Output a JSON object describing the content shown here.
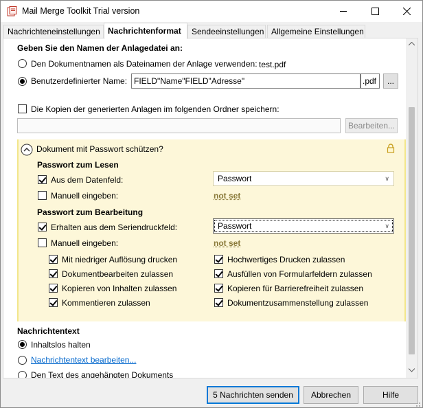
{
  "window": {
    "title": "Mail Merge Toolkit Trial version"
  },
  "tabs": [
    {
      "label": "Nachrichteneinstellungen"
    },
    {
      "label": "Nachrichtenformat"
    },
    {
      "label": "Sendeeinstellungen"
    },
    {
      "label": "Allgemeine Einstellungen"
    }
  ],
  "attachment": {
    "heading": "Geben Sie den Namen der Anlagedatei an:",
    "option_doc_name": "Den Dokumentnamen als Dateinamen der Anlage verwenden:",
    "doc_name_value": "test.pdf",
    "option_custom": "Benutzerdefinierter Name:",
    "custom_value": "FIELD\"Name\"FIELD\"Adresse\"",
    "extension": ".pdf",
    "browse_label": "...",
    "save_copies_label": "Die Kopien der generierten Anlagen im folgenden Ordner speichern:",
    "folder_value": "",
    "edit_button": "Bearbeiten..."
  },
  "password": {
    "toggle_label": "Dokument mit Passwort schützen?",
    "read_heading": "Passwort zum Lesen",
    "read_from_field": "Aus dem Datenfeld:",
    "read_field_value": "Passwort",
    "read_manual": "Manuell eingeben:",
    "read_manual_value": "not set",
    "edit_heading": "Passwort zum Bearbeitung",
    "edit_from_field": "Erhalten aus dem Seriendruckfeld:",
    "edit_field_value": "Passwort",
    "edit_manual": "Manuell eingeben:",
    "edit_manual_value": "not set",
    "permissions": [
      {
        "label": "Mit niedriger Auflösung drucken",
        "checked": true
      },
      {
        "label": "Hochwertiges Drucken zulassen",
        "checked": true
      },
      {
        "label": "Dokumentbearbeiten zulassen",
        "checked": true
      },
      {
        "label": "Ausfüllen von Formularfeldern zulassen",
        "checked": true
      },
      {
        "label": "Kopieren von Inhalten zulassen",
        "checked": true
      },
      {
        "label": "Kopieren für Barrierefreiheit zulassen",
        "checked": true
      },
      {
        "label": "Kommentieren zulassen",
        "checked": true
      },
      {
        "label": "Dokumentzusammenstellung zulassen",
        "checked": true
      }
    ]
  },
  "message_text": {
    "heading": "Nachrichtentext",
    "option_empty": "Inhaltslos halten",
    "option_edit": "Nachrichtentext bearbeiten...",
    "option_attached": "Den Text des angehängten Dokuments"
  },
  "buttons": {
    "send": "5 Nachrichten senden",
    "cancel": "Abbrechen",
    "help": "Hilfe"
  }
}
